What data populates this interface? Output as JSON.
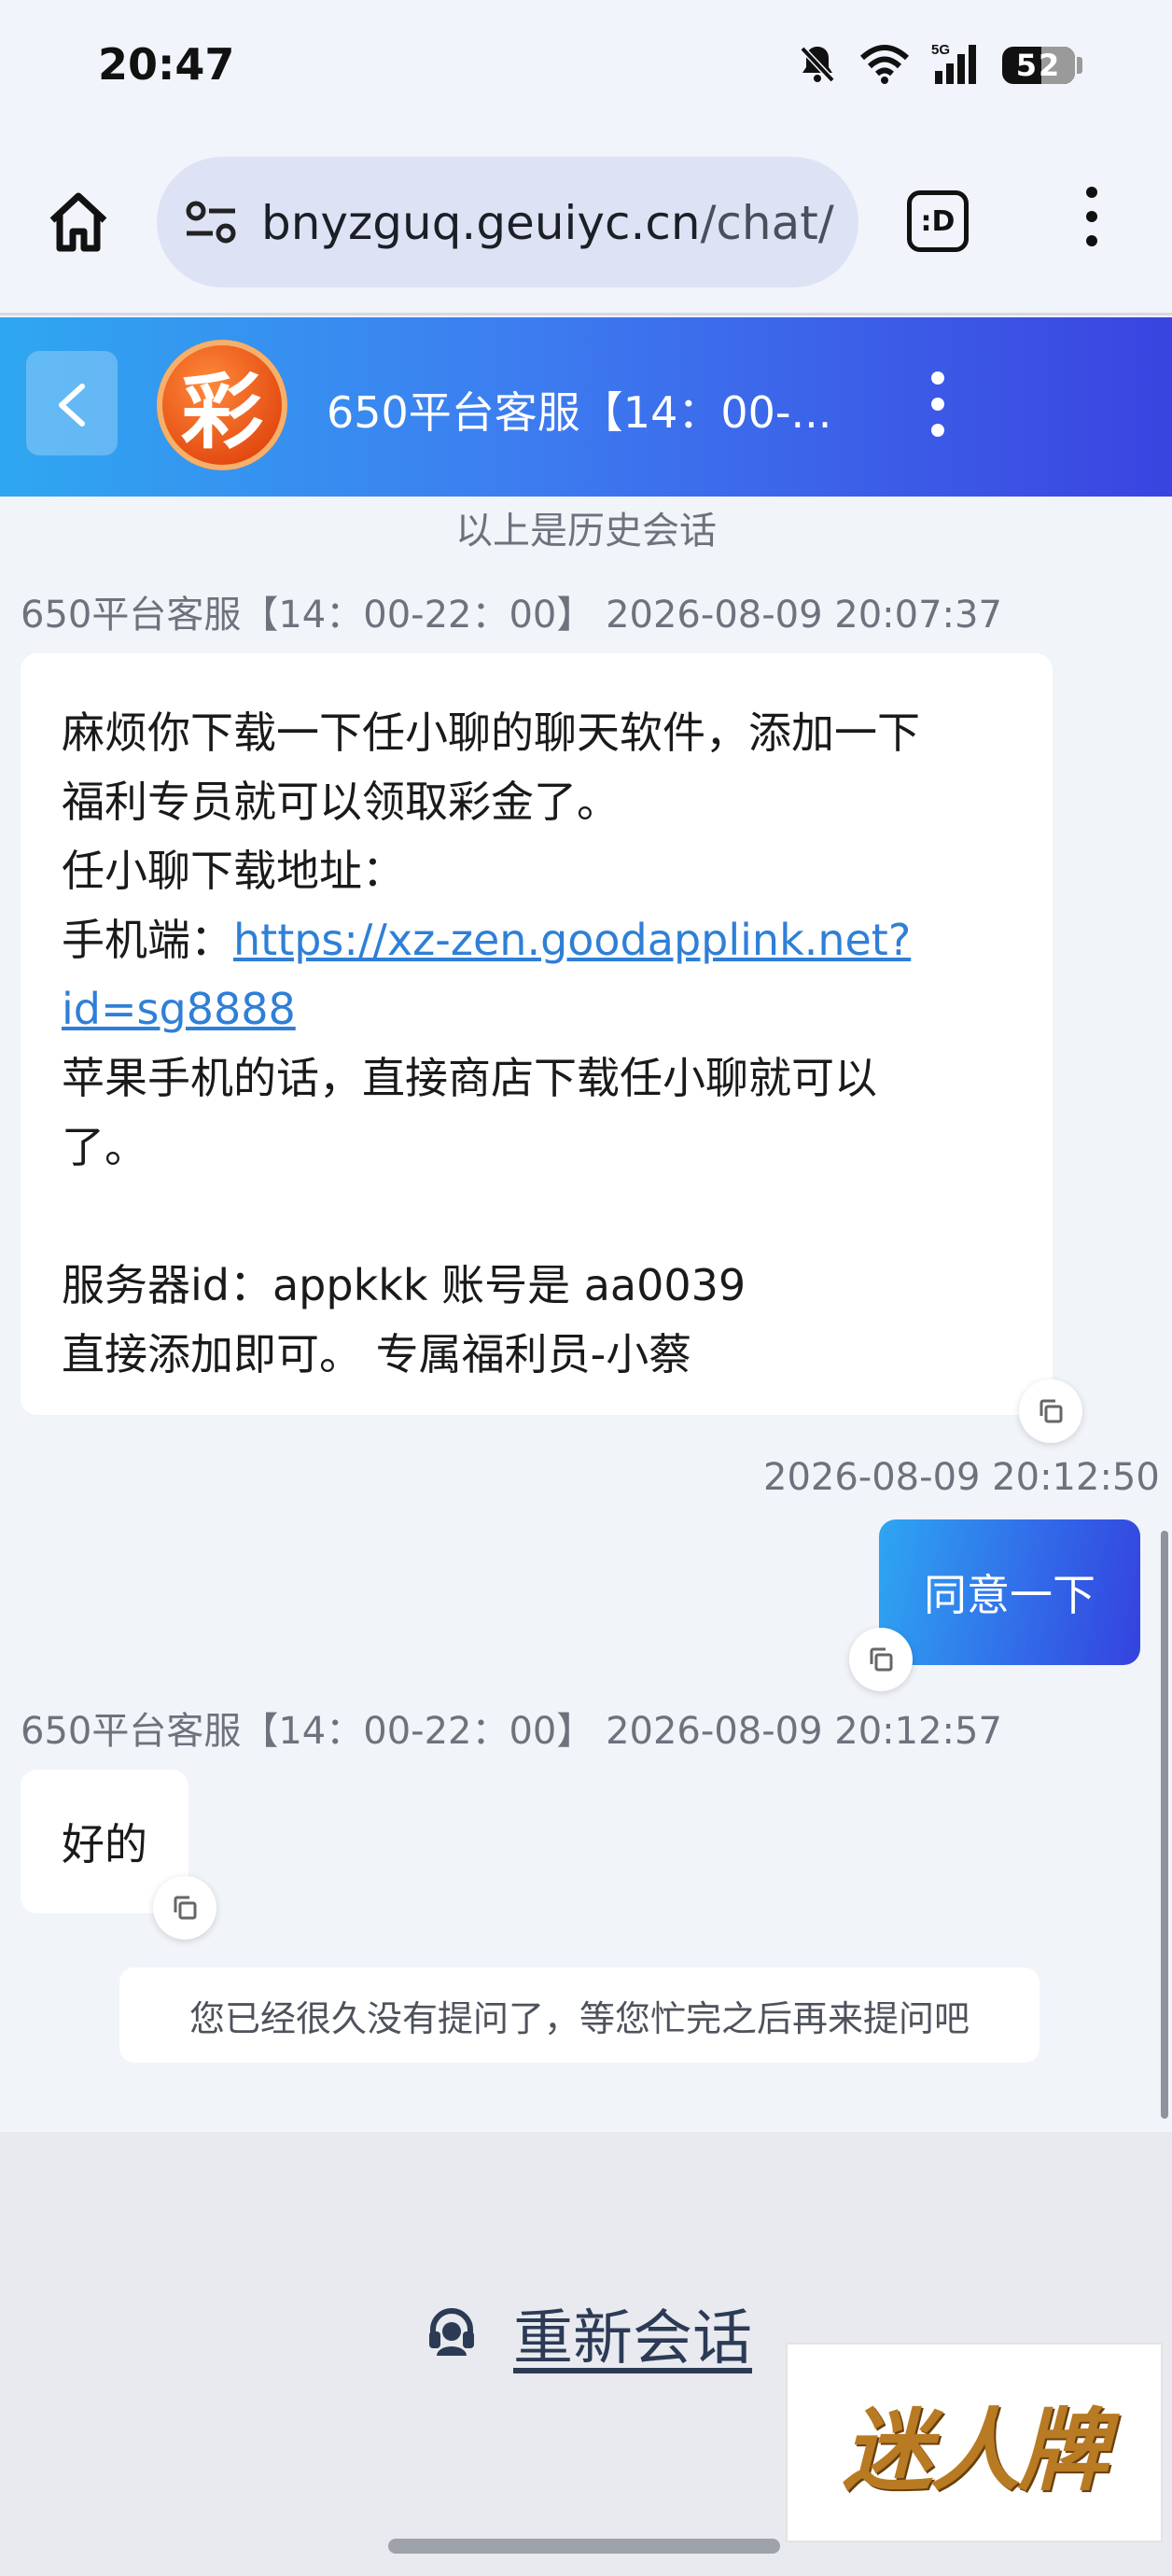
{
  "status_bar": {
    "time": "20:47",
    "battery": "52",
    "network": "5G"
  },
  "browser": {
    "url_host": "bnyzguq.geuiyc.cn",
    "url_path": "/chat/",
    "tab_switch_label": ":D"
  },
  "chat_header": {
    "title": "650平台客服【14：00-...",
    "logo_char": "彩"
  },
  "history_note": "以上是历史会话",
  "messages": [
    {
      "meta": "650平台客服【14：00-22：00】 2026-08-09 20:07:37",
      "lines": [
        "麻烦你下载一下任小聊的聊天软件，添加一下",
        "福利专员就可以领取彩金了。",
        "任小聊下载地址：",
        "手机端：",
        "https://xz-zen.goodapplink.net?",
        "id=sg8888",
        "苹果手机的话，直接商店下载任小聊就可以",
        "了。",
        "服务器id：appkkk  账号是  aa0039",
        "直接添加即可。   专属福利员-小蔡"
      ]
    },
    {
      "meta": "2026-08-09 20:12:50",
      "text": "同意一下"
    },
    {
      "meta": "650平台客服【14：00-22：00】 2026-08-09 20:12:57",
      "text": "好的"
    }
  ],
  "idle_note": "您已经很久没有提问了，等您忙完之后再来提问吧",
  "footer": {
    "restart_label": "重新会话",
    "badge_text": "迷人牌"
  },
  "colors": {
    "header_start": "#2fa7f0",
    "header_end": "#3a44e0",
    "link": "#2f7fd6"
  }
}
